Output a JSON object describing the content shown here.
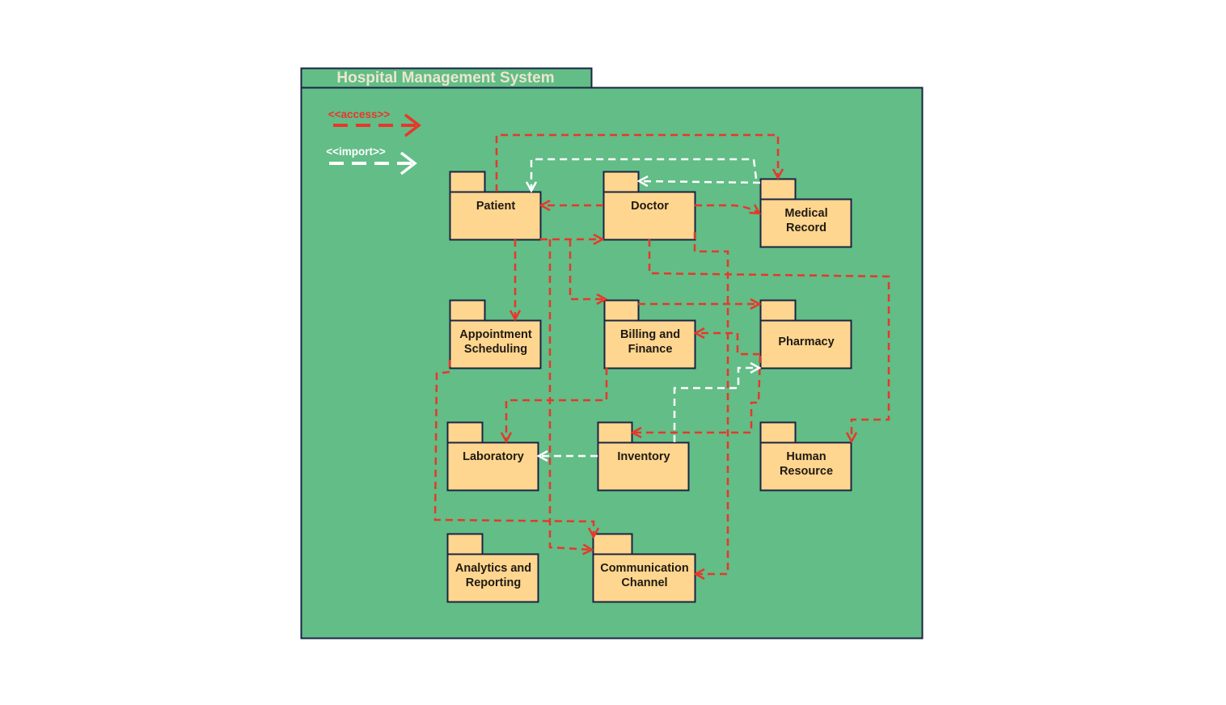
{
  "frame": {
    "title": "Hospital Management System"
  },
  "colors": {
    "background": "#62BD87",
    "border": "#1B2443",
    "package_fill": "#FFD68F",
    "access": "#E8372A",
    "import": "#FFFFFF"
  },
  "legend": [
    {
      "type": "access",
      "label": "<<access>>"
    },
    {
      "type": "import",
      "label": "<<import>>"
    }
  ],
  "packages": [
    {
      "id": "patient",
      "lines": [
        "Patient"
      ]
    },
    {
      "id": "doctor",
      "lines": [
        "Doctor"
      ]
    },
    {
      "id": "medical_record",
      "lines": [
        "Medical",
        "Record"
      ]
    },
    {
      "id": "appointment",
      "lines": [
        "Appointment",
        "Scheduling"
      ]
    },
    {
      "id": "billing",
      "lines": [
        "Billing and",
        "Finance"
      ]
    },
    {
      "id": "pharmacy",
      "lines": [
        "Pharmacy"
      ]
    },
    {
      "id": "laboratory",
      "lines": [
        "Laboratory"
      ]
    },
    {
      "id": "inventory",
      "lines": [
        "Inventory"
      ]
    },
    {
      "id": "human_resource",
      "lines": [
        "Human",
        "Resource"
      ]
    },
    {
      "id": "analytics",
      "lines": [
        "Analytics and",
        "Reporting"
      ]
    },
    {
      "id": "communication",
      "lines": [
        "Communication",
        "Channel"
      ]
    }
  ],
  "relationships": [
    {
      "from": "patient",
      "to": "medical_record",
      "type": "access"
    },
    {
      "from": "doctor",
      "to": "patient",
      "type": "access"
    },
    {
      "from": "patient",
      "to": "doctor",
      "type": "access"
    },
    {
      "from": "doctor",
      "to": "medical_record",
      "type": "access"
    },
    {
      "from": "patient",
      "to": "appointment",
      "type": "access"
    },
    {
      "from": "patient",
      "to": "billing",
      "type": "access"
    },
    {
      "from": "billing",
      "to": "pharmacy",
      "type": "access"
    },
    {
      "from": "doctor",
      "to": "human_resource",
      "type": "access"
    },
    {
      "from": "doctor",
      "to": "communication",
      "type": "access"
    },
    {
      "from": "pharmacy",
      "to": "billing",
      "type": "access"
    },
    {
      "from": "pharmacy",
      "to": "inventory",
      "type": "access"
    },
    {
      "from": "billing",
      "to": "laboratory",
      "type": "access"
    },
    {
      "from": "appointment",
      "to": "communication",
      "type": "access"
    },
    {
      "from": "patient",
      "to": "communication",
      "type": "access"
    },
    {
      "from": "medical_record",
      "to": "patient",
      "type": "import"
    },
    {
      "from": "medical_record",
      "to": "doctor",
      "type": "import"
    },
    {
      "from": "inventory",
      "to": "pharmacy",
      "type": "import"
    },
    {
      "from": "inventory",
      "to": "laboratory",
      "type": "import"
    }
  ]
}
